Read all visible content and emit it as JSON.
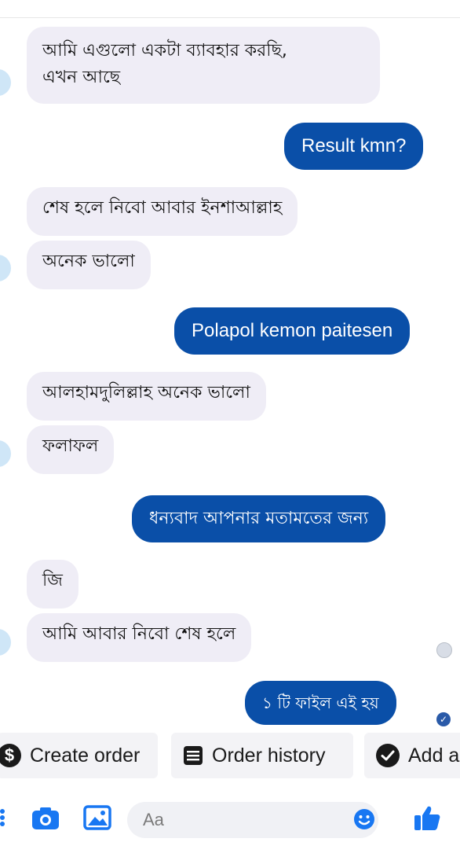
{
  "messages": [
    {
      "dir": "in",
      "text_line1": "আমি এগুলো একটা ব্যাবহার করছি,",
      "text_line2": "এখন আছে"
    },
    {
      "dir": "out",
      "text": "Result kmn?"
    },
    {
      "dir": "in",
      "text": "শেষ হলে নিবো আবার ইনশাআল্লাহ"
    },
    {
      "dir": "in",
      "text": "অনেক ভালো"
    },
    {
      "dir": "out",
      "text": "Polapol kemon paitesen"
    },
    {
      "dir": "in",
      "text": "আলহামদুলিল্লাহ অনেক ভালো"
    },
    {
      "dir": "in",
      "text": "ফলাফল"
    },
    {
      "dir": "out",
      "text": "ধন্যবাদ আপনার মতামতের জন্য"
    },
    {
      "dir": "in",
      "text": "জি"
    },
    {
      "dir": "in",
      "text": "আমি আবার নিবো শেষ হলে"
    },
    {
      "dir": "out",
      "text": "১ টি ফাইল এই হয়"
    }
  ],
  "actions": {
    "create_order": "Create order",
    "order_history": "Order history",
    "add": "Add a"
  },
  "composer": {
    "placeholder": "Aa"
  },
  "colors": {
    "outgoing": "#0a4fa8",
    "incoming": "#efedf6",
    "accent": "#1877f2"
  },
  "icons": [
    "dollar-icon",
    "list-icon",
    "check-circle-icon",
    "camera-icon",
    "image-icon",
    "emoji-icon",
    "like-icon"
  ]
}
